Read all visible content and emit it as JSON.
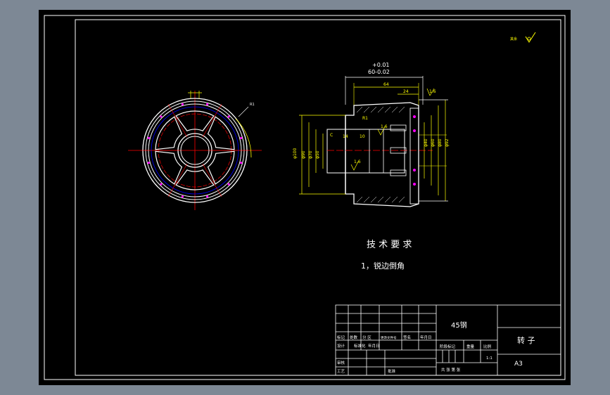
{
  "tech_requirements": {
    "title": "技 术 要 求",
    "item_1": "1，锐边倒角"
  },
  "dimensions": {
    "tolerance_upper": "+0.01",
    "main_length": "60-0.02"
  },
  "title_block": {
    "material": "45钢",
    "part_name": "转 子",
    "sheet_size": "A3",
    "scale_value": "1:1",
    "row_headers": [
      "标记",
      "处数",
      "分 区",
      "更改文件号",
      "签名",
      "年月日"
    ],
    "row_headers_2": [
      "设计",
      "标准化",
      "年月日",
      "阶段标记",
      "重量",
      "比例"
    ],
    "row_review": "审核",
    "row_process": "工艺",
    "row_approve": "批准",
    "sheet_count": "共  张  第  张"
  },
  "colors": {
    "background": "#7d8895",
    "sheet": "#000000",
    "line": "#ffffff",
    "dimension": "#ffff00",
    "centerline": "#ff0000",
    "hidden": "#0000ff",
    "section": "#ff00ff"
  }
}
